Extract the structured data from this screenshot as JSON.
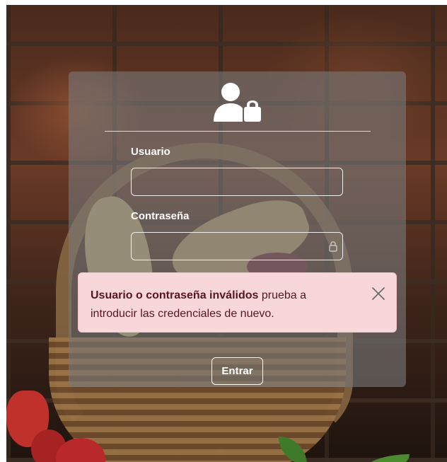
{
  "login": {
    "username_label": "Usuario",
    "username_value": "",
    "password_label": "Contraseña",
    "password_value": "",
    "submit_label": "Entrar"
  },
  "alert": {
    "bold_text": "Usuario o contraseña inválidos",
    "message": " prueba a introducir las credenciales de nuevo."
  },
  "icons": {
    "header": "user-lock-icon",
    "password_field": "lock-icon",
    "alert_close": "close-icon"
  },
  "colors": {
    "alert_background": "#f8d7da",
    "alert_text": "#58151c",
    "card_overlay": "rgba(120,120,120,0.62)"
  }
}
